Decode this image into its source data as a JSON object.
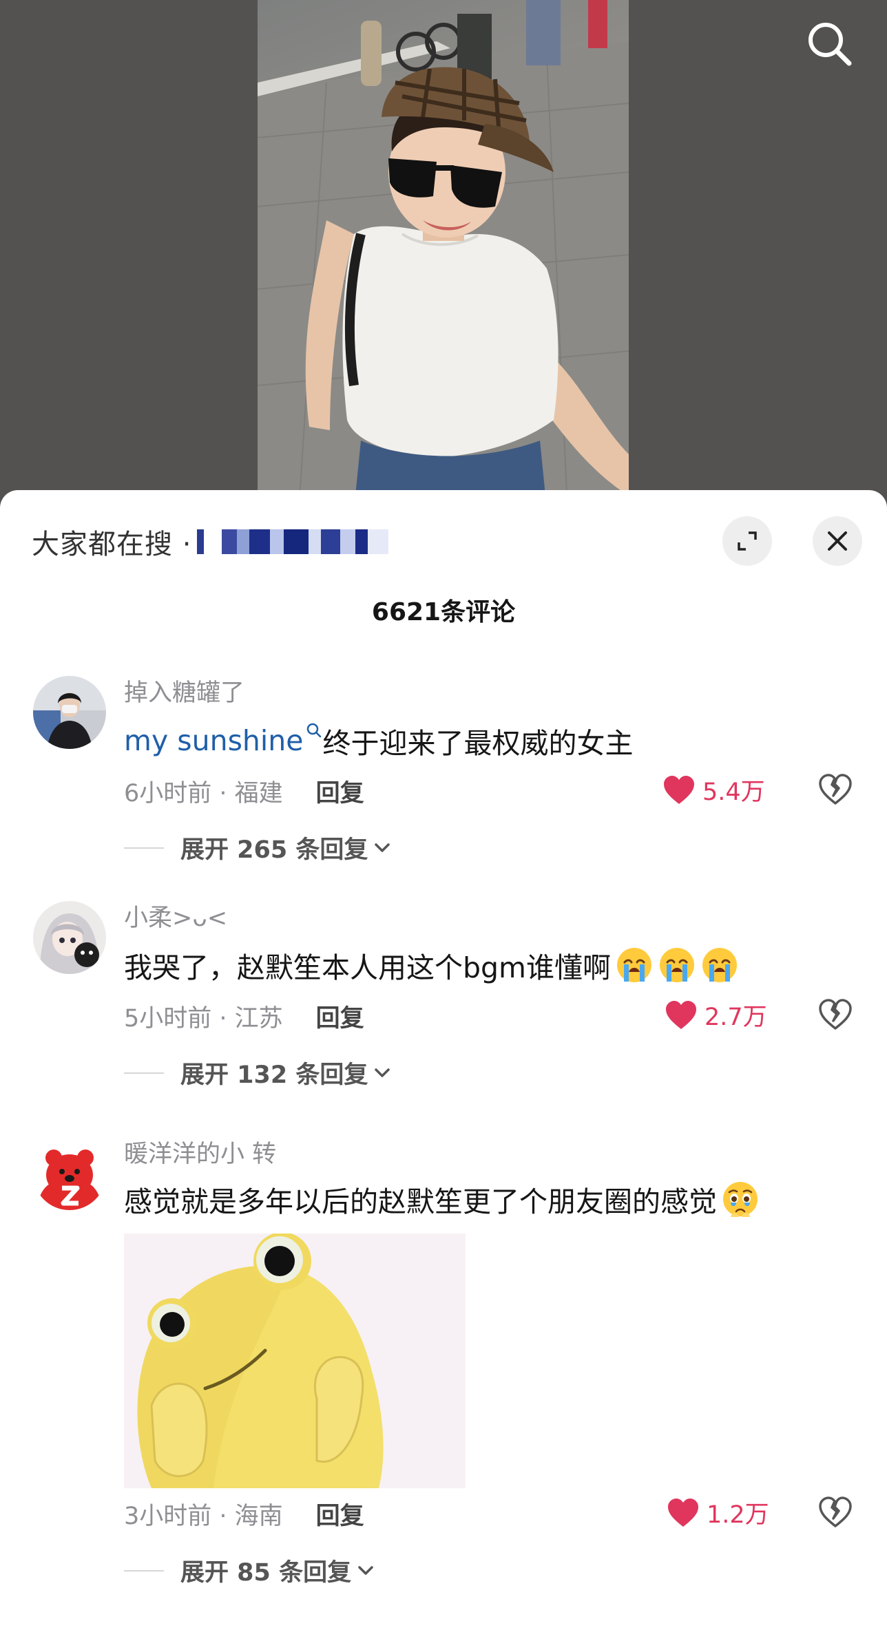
{
  "video": {
    "search_icon": "search-icon"
  },
  "sheet": {
    "search_hint_label": "大家都在搜 ·",
    "comment_count": "6621条评论",
    "expand_icon": "expand-icon",
    "close_icon": "close-icon"
  },
  "comments": [
    {
      "username": "掉入糖罐了",
      "mention": "my sunshine",
      "text": "终于迎来了最权威的女主",
      "time": "6小时前",
      "location": "福建",
      "meta": "6小时前 · 福建",
      "reply_label": "回复",
      "likes": "5.4万",
      "expand_label": "展开 265 条回复"
    },
    {
      "username": "小柔>ᴗ<",
      "text": "我哭了，赵默笙本人用这个bgm谁懂啊",
      "emojis": [
        "crying-emoji",
        "crying-emoji",
        "crying-emoji"
      ],
      "meta": "5小时前 · 江苏",
      "reply_label": "回复",
      "likes": "2.7万",
      "expand_label": "展开 132 条回复"
    },
    {
      "username": "暖洋洋的小 转",
      "text": "感觉就是多年以后的赵默笙更了个朋友圈的感觉",
      "emojis": [
        "teary-emoji"
      ],
      "sticker": "yellow-blob-sticker",
      "meta": "3小时前 · 海南",
      "reply_label": "回复",
      "likes": "1.2万",
      "expand_label": "展开 85 条回复"
    }
  ],
  "colors": {
    "like_red": "#e0365e",
    "mention_blue": "#1f5fa8",
    "meta_gray": "#8e8e93"
  }
}
